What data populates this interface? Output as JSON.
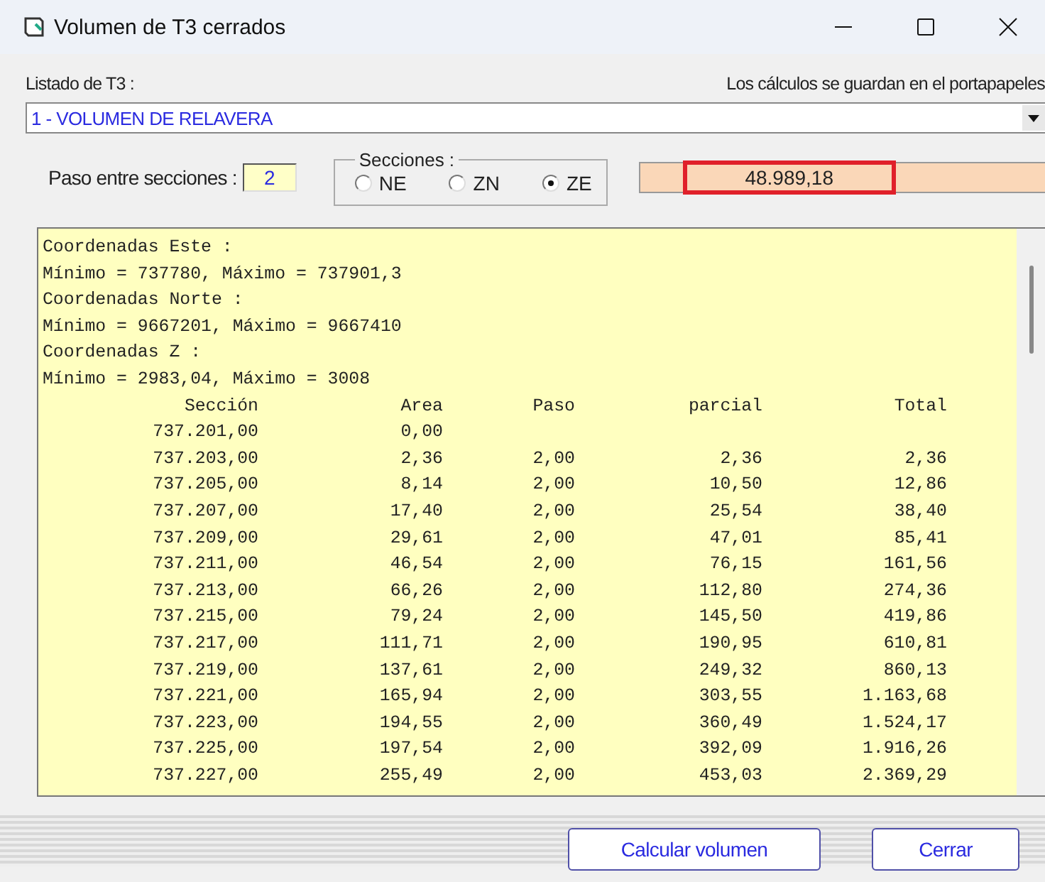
{
  "window": {
    "title": "Volumen de T3 cerrados"
  },
  "list_label": "Listado de T3 :",
  "clipboard_note": "Los cálculos se guardan en el portapapeles",
  "dropdown": {
    "value": "1 - VOLUMEN DE RELAVERA"
  },
  "step": {
    "label": "Paso entre secciones :",
    "value": "2"
  },
  "sections": {
    "title": "Secciones :",
    "options": [
      {
        "label": "NE",
        "selected": false
      },
      {
        "label": "ZN",
        "selected": false
      },
      {
        "label": "ZE",
        "selected": true
      }
    ]
  },
  "result": "48.989,18",
  "summary_lines": [
    "Coordenadas Este :",
    "Mínimo = 737780, Máximo = 737901,3",
    "Coordenadas Norte :",
    "Mínimo = 9667201, Máximo = 9667410",
    "Coordenadas Z :",
    "Mínimo = 2983,04, Máximo = 3008"
  ],
  "table": {
    "columns": [
      "Sección",
      "Area",
      "Paso",
      "parcial",
      "Total"
    ],
    "rows": [
      [
        "737.201,00",
        "0,00",
        "",
        "",
        ""
      ],
      [
        "737.203,00",
        "2,36",
        "2,00",
        "2,36",
        "2,36"
      ],
      [
        "737.205,00",
        "8,14",
        "2,00",
        "10,50",
        "12,86"
      ],
      [
        "737.207,00",
        "17,40",
        "2,00",
        "25,54",
        "38,40"
      ],
      [
        "737.209,00",
        "29,61",
        "2,00",
        "47,01",
        "85,41"
      ],
      [
        "737.211,00",
        "46,54",
        "2,00",
        "76,15",
        "161,56"
      ],
      [
        "737.213,00",
        "66,26",
        "2,00",
        "112,80",
        "274,36"
      ],
      [
        "737.215,00",
        "79,24",
        "2,00",
        "145,50",
        "419,86"
      ],
      [
        "737.217,00",
        "111,71",
        "2,00",
        "190,95",
        "610,81"
      ],
      [
        "737.219,00",
        "137,61",
        "2,00",
        "249,32",
        "860,13"
      ],
      [
        "737.221,00",
        "165,94",
        "2,00",
        "303,55",
        "1.163,68"
      ],
      [
        "737.223,00",
        "194,55",
        "2,00",
        "360,49",
        "1.524,17"
      ],
      [
        "737.225,00",
        "197,54",
        "2,00",
        "392,09",
        "1.916,26"
      ],
      [
        "737.227,00",
        "255,49",
        "2,00",
        "453,03",
        "2.369,29"
      ]
    ]
  },
  "buttons": [
    "Calcular volumen",
    "Cerrar"
  ]
}
